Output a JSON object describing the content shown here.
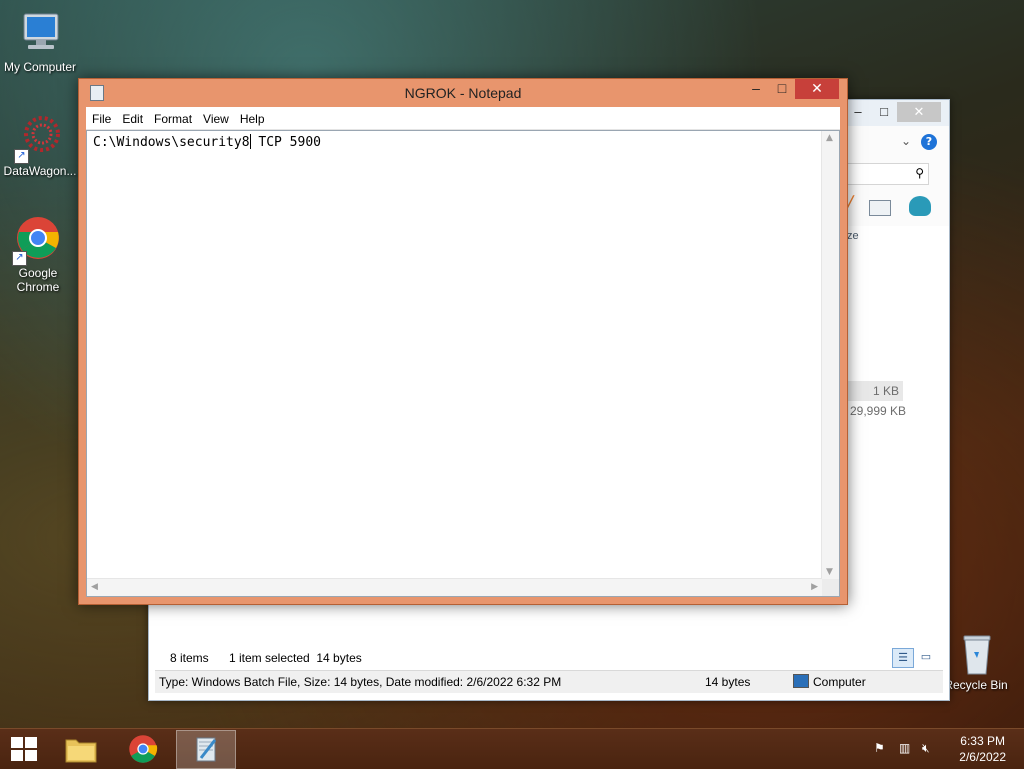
{
  "desktop": {
    "icons": [
      {
        "label": "My Computer"
      },
      {
        "label": "DataWagon..."
      },
      {
        "label": "Google Chrome"
      },
      {
        "label": "Recycle Bin"
      }
    ]
  },
  "explorer": {
    "controls": {
      "minimize": "–",
      "maximize": "□",
      "close": "✕"
    },
    "column_fragment": "ze",
    "file_sizes": [
      "1 KB",
      "29,999 KB"
    ],
    "status_bar": {
      "item_count": "8 items",
      "selection": "1 item selected  14 bytes"
    },
    "details_bar": {
      "info": "Type: Windows Batch File, Size: 14 bytes, Date modified: 2/6/2022 6:32 PM",
      "size": "14 bytes",
      "location": "Computer"
    }
  },
  "notepad": {
    "title": "NGROK - Notepad",
    "controls": {
      "minimize": "–",
      "maximize": "□",
      "close": "✕"
    },
    "menu": [
      "File",
      "Edit",
      "Format",
      "View",
      "Help"
    ],
    "content_before_caret": "C:\\Windows\\security8",
    "content_after_caret": " TCP 5900"
  },
  "taskbar": {
    "clock": {
      "time": "6:33 PM",
      "date": "2/6/2022"
    },
    "accent": "#e8956d"
  }
}
